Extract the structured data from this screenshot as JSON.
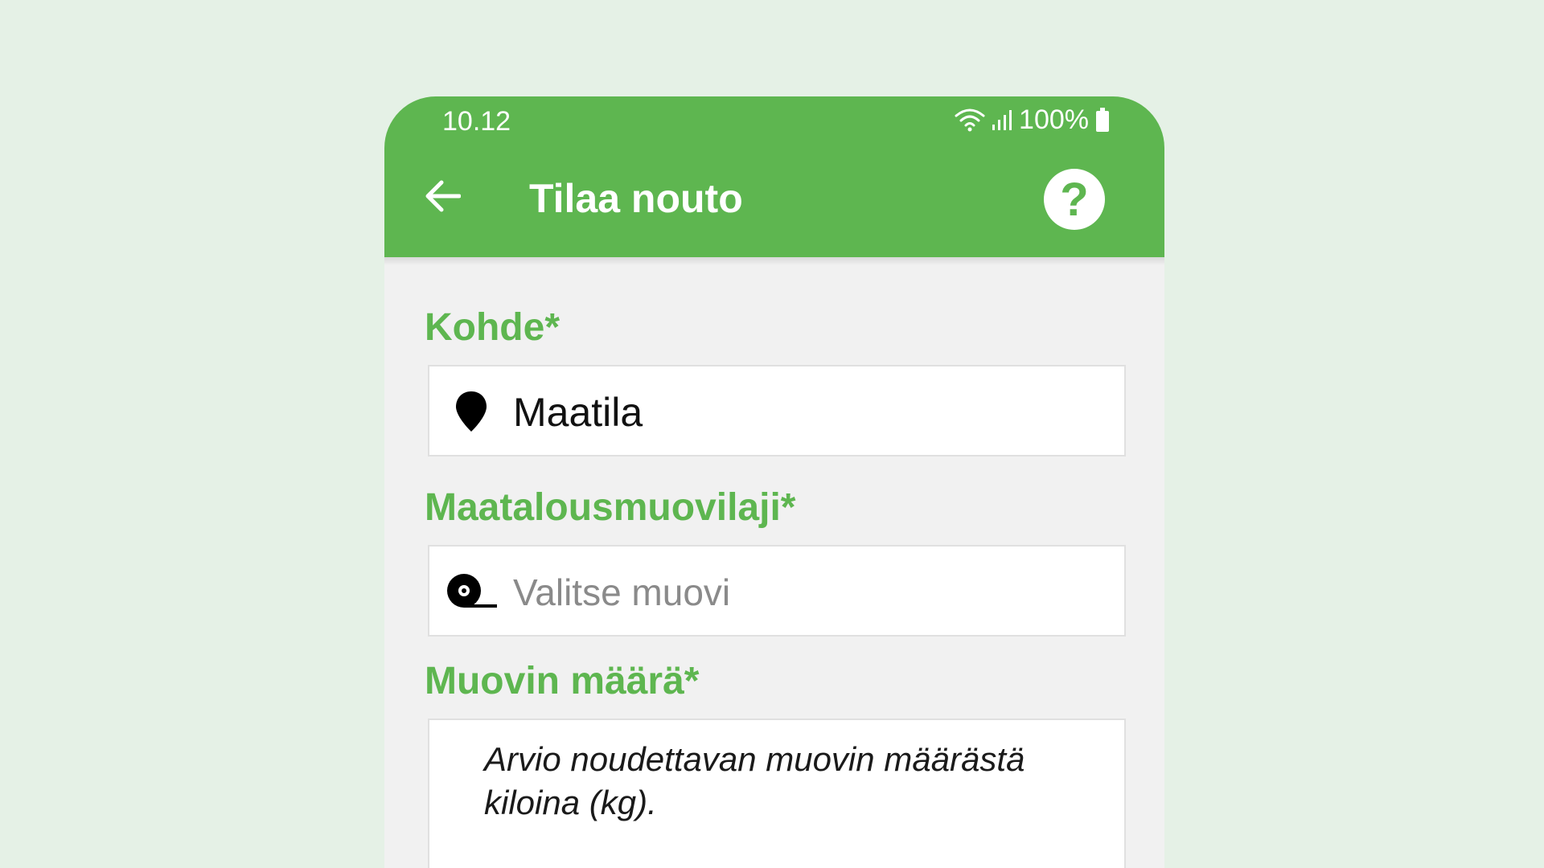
{
  "status_bar": {
    "time": "10.12",
    "battery": "100%",
    "icons": [
      "wifi-icon",
      "signal-icon",
      "battery-icon"
    ]
  },
  "header": {
    "title": "Tilaa nouto",
    "back_icon": "arrow-left-icon",
    "help_icon": "question-circle-icon",
    "help_glyph": "?"
  },
  "form": {
    "target": {
      "label": "Kohde*",
      "icon": "location-pin-icon",
      "value": "Maatila"
    },
    "plastic_type": {
      "label": "Maatalousmuovilaji*",
      "icon": "plastic-roll-icon",
      "placeholder": "Valitse muovi"
    },
    "amount": {
      "label": "Muovin määrä*",
      "hint": "Arvio noudettavan muovin määrästä kiloina (kg)."
    }
  },
  "colors": {
    "brand_green": "#5eb650",
    "page_background": "#e5f1e6",
    "form_background": "#f1f1f1"
  }
}
